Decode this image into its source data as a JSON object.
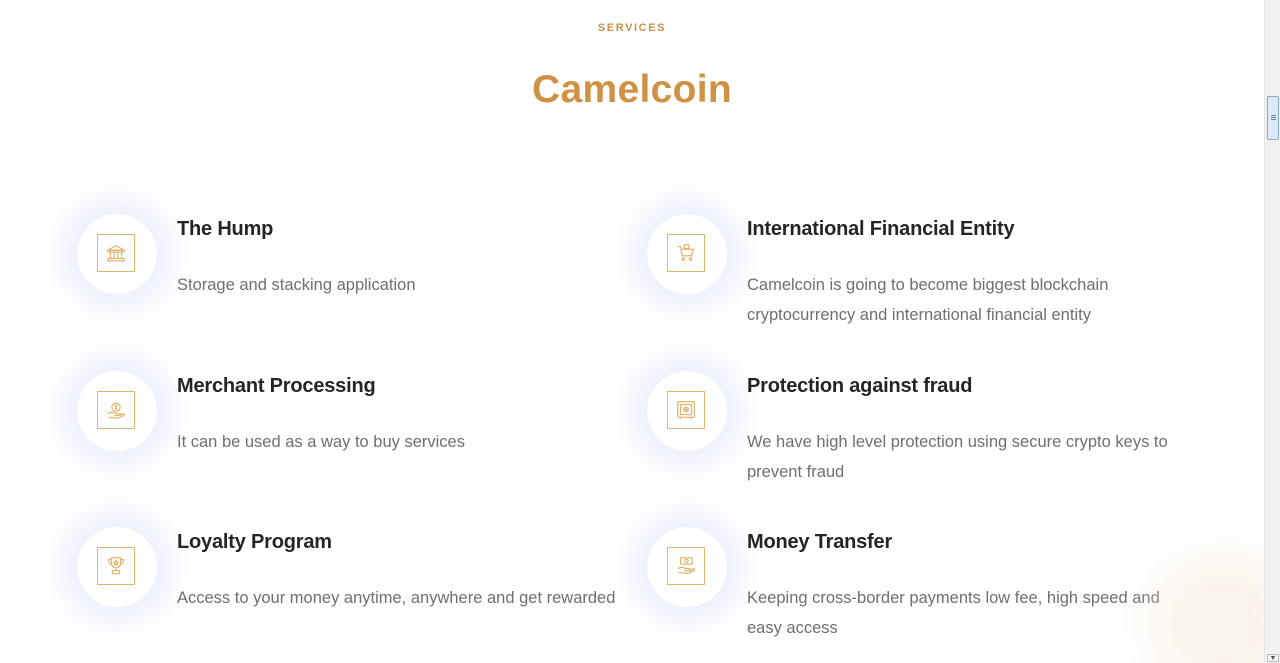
{
  "section": {
    "eyebrow": "SERVICES",
    "title": "Camelcoin"
  },
  "services": [
    {
      "title": "The Hump",
      "description": "Storage and stacking application",
      "icon": "bank-icon"
    },
    {
      "title": "International Financial Entity",
      "description": "Camelcoin is going to become biggest blockchain cryptocurrency and international financial entity",
      "icon": "shopping-cart-icon"
    },
    {
      "title": "Merchant Processing",
      "description": "It can be used as a way to buy services",
      "icon": "money-hand-icon"
    },
    {
      "title": "Protection against fraud",
      "description": "We have high level protection using secure crypto keys to prevent fraud",
      "icon": "safe-icon"
    },
    {
      "title": "Loyalty Program",
      "description": "Access to your money anytime, anywhere and get rewarded",
      "icon": "trophy-icon"
    },
    {
      "title": "Money Transfer",
      "description": "Keeping cross-border payments low fee, high speed and easy access",
      "icon": "cash-transfer-icon"
    }
  ],
  "colors": {
    "accent": "#cf9245",
    "heading": "#252525",
    "body_text": "#6f6f6f",
    "icon_stroke": "#e0b36e"
  }
}
